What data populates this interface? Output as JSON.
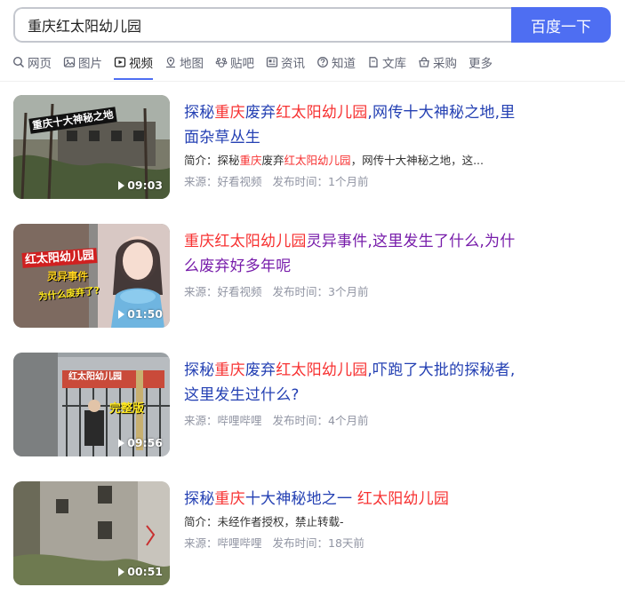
{
  "search": {
    "query": "重庆红太阳幼儿园",
    "button_label": "百度一下"
  },
  "tabs": [
    {
      "label": "网页",
      "icon": "search-icon"
    },
    {
      "label": "图片",
      "icon": "image-icon"
    },
    {
      "label": "视频",
      "icon": "video-icon"
    },
    {
      "label": "地图",
      "icon": "map-icon"
    },
    {
      "label": "贴吧",
      "icon": "paw-icon"
    },
    {
      "label": "资讯",
      "icon": "news-icon"
    },
    {
      "label": "知道",
      "icon": "question-icon"
    },
    {
      "label": "文库",
      "icon": "document-icon"
    },
    {
      "label": "采购",
      "icon": "basket-icon"
    },
    {
      "label": "更多",
      "icon": ""
    }
  ],
  "active_tab": "视频",
  "results": [
    {
      "title_parts": [
        [
          "探秘",
          0
        ],
        [
          "重庆",
          1
        ],
        [
          "废弃",
          0
        ],
        [
          "红太阳幼儿园",
          1
        ],
        [
          ",网传十大神秘之地,里面杂草丛生",
          0
        ]
      ],
      "summary_parts": [
        [
          "简介：探秘",
          0
        ],
        [
          "重庆",
          1
        ],
        [
          "废弃",
          0
        ],
        [
          "红太阳幼儿园",
          1
        ],
        [
          "，网传十大神秘之地，这...",
          0
        ]
      ],
      "source": "来源：好看视频",
      "time": "发布时间：1个月前",
      "duration": "09:03",
      "thumb_text": "重庆十大神秘之地",
      "visited": false
    },
    {
      "title_parts": [
        [
          "重庆",
          1
        ],
        [
          "红太阳幼儿园",
          1
        ],
        [
          "灵异事件,这里发生了什么,为什么废弃好多年呢",
          0
        ]
      ],
      "summary_parts": [],
      "source": "来源：好看视频",
      "time": "发布时间：3个月前",
      "duration": "01:50",
      "thumb_text": "红太阳幼儿园",
      "thumb_text2": "灵异事件",
      "thumb_text3": "为什么废弃了?",
      "visited": true
    },
    {
      "title_parts": [
        [
          "探秘",
          0
        ],
        [
          "重庆",
          1
        ],
        [
          "废弃",
          0
        ],
        [
          "红太阳幼儿园",
          1
        ],
        [
          ",吓跑了大批的探秘者,这里发生过什么?",
          0
        ]
      ],
      "summary_parts": [],
      "source": "来源：哔哩哔哩",
      "time": "发布时间：4个月前",
      "duration": "09:56",
      "thumb_text": "红太阳幼儿园",
      "thumb_text2": "完整版",
      "visited": false
    },
    {
      "title_parts": [
        [
          "探秘",
          0
        ],
        [
          "重庆",
          1
        ],
        [
          "十大神秘地之一 ",
          0
        ],
        [
          "红太阳幼儿园",
          1
        ]
      ],
      "summary_parts": [
        [
          "简介：未经作者授权，禁止转载-",
          0
        ]
      ],
      "source": "来源：哔哩哔哩",
      "time": "发布时间：18天前",
      "duration": "00:51",
      "visited": false
    }
  ],
  "colors": {
    "accent": "#4e6ef2",
    "link": "#2440b3",
    "visited": "#771caa",
    "highlight": "#f73131",
    "meta": "#9195a3"
  }
}
